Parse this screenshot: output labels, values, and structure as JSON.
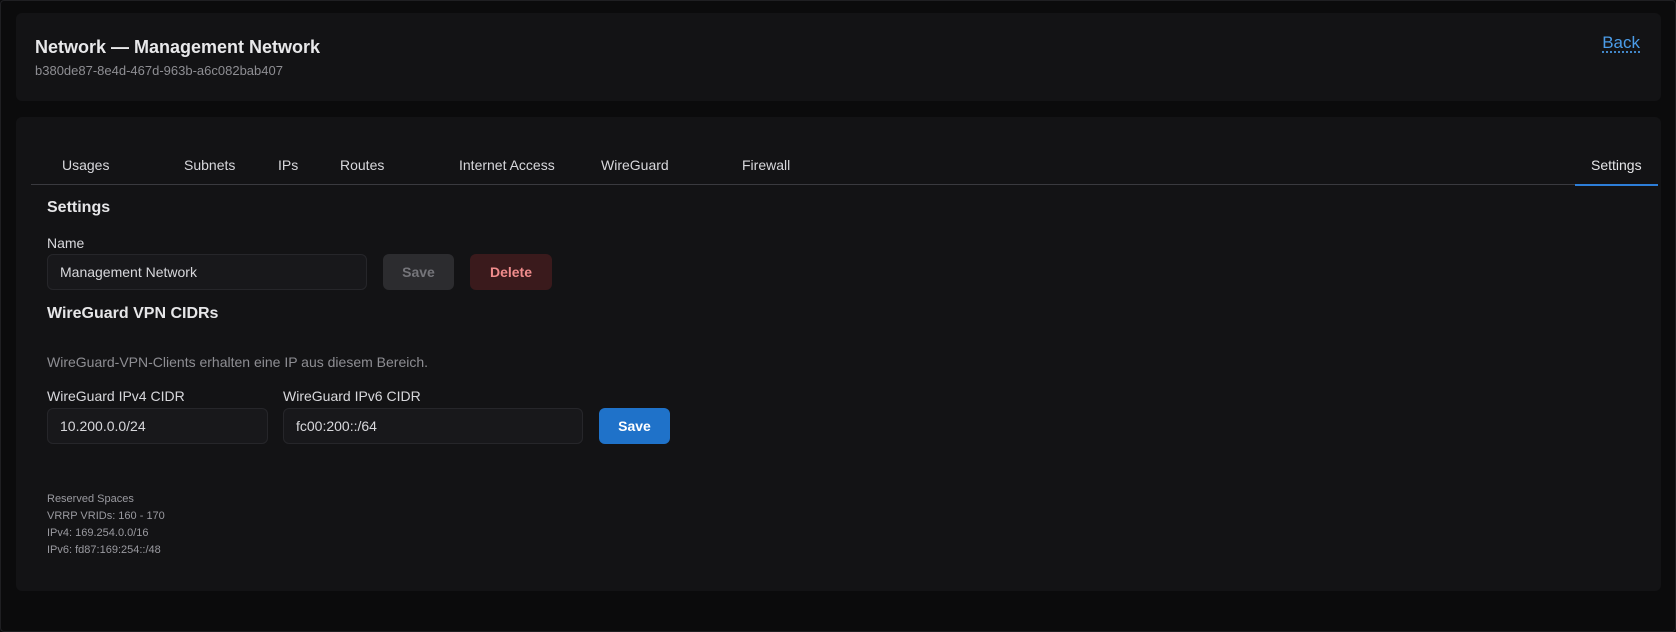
{
  "header": {
    "title": "Network — Management Network",
    "id": "b380de87-8e4d-467d-963b-a6c082bab407",
    "back_label": "Back"
  },
  "tabs": [
    {
      "label": "Usages",
      "active": false
    },
    {
      "label": "Subnets",
      "active": false
    },
    {
      "label": "IPs",
      "active": false
    },
    {
      "label": "Routes",
      "active": false
    },
    {
      "label": "Internet Access",
      "active": false
    },
    {
      "label": "WireGuard",
      "active": false
    },
    {
      "label": "Firewall",
      "active": false
    },
    {
      "label": "Settings",
      "active": true
    }
  ],
  "settings": {
    "title": "Settings",
    "name_label": "Name",
    "name_value": "Management Network",
    "save_label": "Save",
    "delete_label": "Delete"
  },
  "wireguard": {
    "title": "WireGuard VPN CIDRs",
    "description": "WireGuard-VPN-Clients erhalten eine IP aus diesem Bereich.",
    "ipv4_label": "WireGuard IPv4 CIDR",
    "ipv4_value": "10.200.0.0/24",
    "ipv6_label": "WireGuard IPv6 CIDR",
    "ipv6_value": "fc00:200::/64",
    "save_label": "Save"
  },
  "reserved": {
    "title": "Reserved Spaces",
    "vrrp": "VRRP VRIDs: 160 - 170",
    "ipv4": "IPv4: 169.254.0.0/16",
    "ipv6": "IPv6: fd87:169:254::/48"
  },
  "colors": {
    "accent": "#1f72c9",
    "link": "#4b9ce8",
    "danger_text": "#f08c8c",
    "background": "#0b0b0c",
    "card": "#131315"
  }
}
